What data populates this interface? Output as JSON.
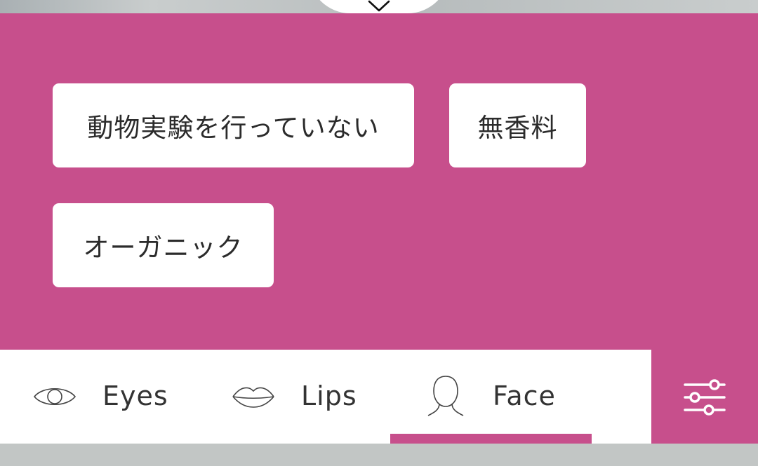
{
  "filters": {
    "chips": [
      {
        "label": "動物実験を行っていない"
      },
      {
        "label": "無香料"
      },
      {
        "label": "オーガニック"
      }
    ]
  },
  "tabs": [
    {
      "label": "Eyes",
      "icon": "eye-icon"
    },
    {
      "label": "Lips",
      "icon": "lips-icon"
    },
    {
      "label": "Face",
      "icon": "face-icon",
      "active": true
    }
  ],
  "colors": {
    "accent": "#c74f8c",
    "tab_background": "#ffffff",
    "chip_text": "#2b2b2b",
    "tab_text": "#333333",
    "backdrop": "#c2c6c5"
  },
  "icons": {
    "collapse": "chevron-down-icon",
    "filter": "sliders-icon"
  }
}
